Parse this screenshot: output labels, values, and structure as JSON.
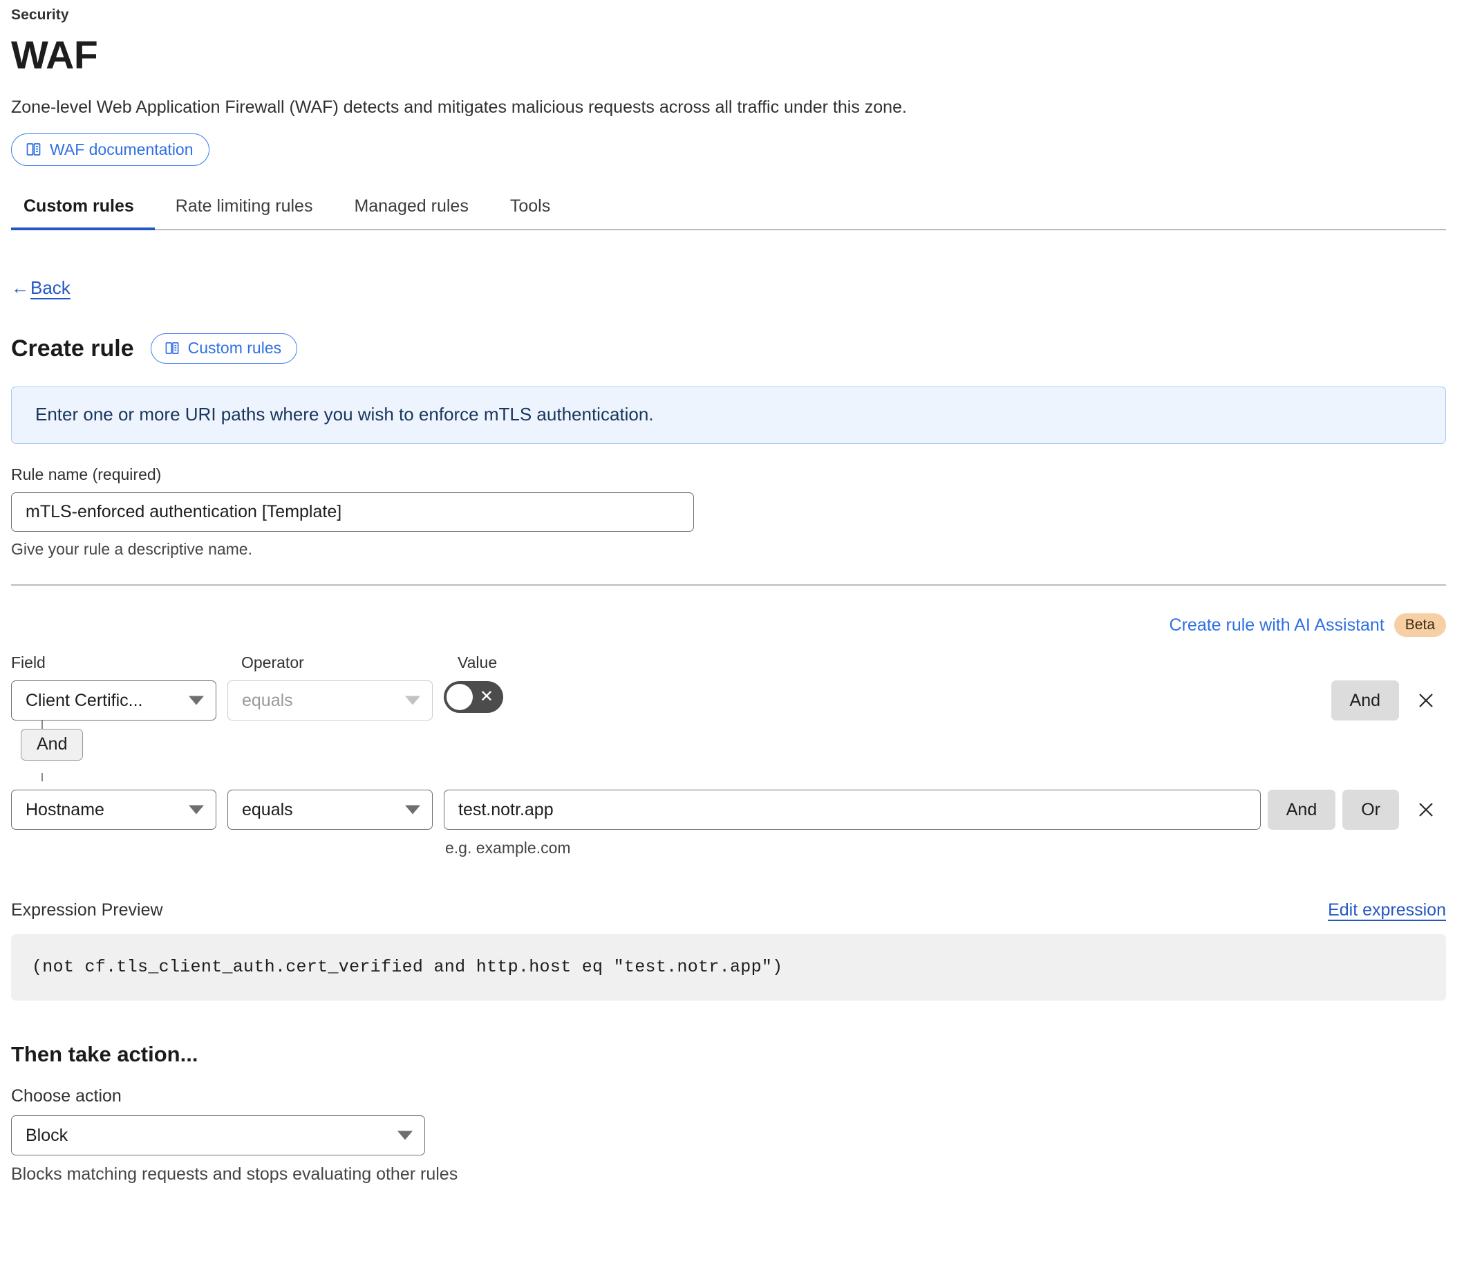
{
  "header": {
    "eyebrow": "Security",
    "title": "WAF",
    "description": "Zone-level Web Application Firewall (WAF) detects and mitigates malicious requests across all traffic under this zone.",
    "doc_button": "WAF documentation",
    "doc_icon": "book-icon"
  },
  "tabs": [
    {
      "label": "Custom rules",
      "active": true
    },
    {
      "label": "Rate limiting rules",
      "active": false
    },
    {
      "label": "Managed rules",
      "active": false
    },
    {
      "label": "Tools",
      "active": false
    }
  ],
  "back": {
    "arrow": "←",
    "label": "Back"
  },
  "create": {
    "title": "Create rule",
    "badge": "Custom rules",
    "badge_icon": "book-icon"
  },
  "banner": {
    "text": "Enter one or more URI paths where you wish to enforce mTLS authentication."
  },
  "rule_name": {
    "label": "Rule name (required)",
    "value": "mTLS-enforced authentication [Template]",
    "placeholder": "Rule name",
    "hint": "Give your rule a descriptive name."
  },
  "ai_assistant": {
    "link": "Create rule with AI Assistant",
    "badge": "Beta"
  },
  "conditions": {
    "headers": {
      "field": "Field",
      "operator": "Operator",
      "value": "Value"
    },
    "rows": [
      {
        "field": "Client Certific...",
        "operator": "equals",
        "operator_disabled": true,
        "value_type": "toggle",
        "value_toggle_on": false,
        "value_toggle_icon": "close-icon",
        "buttons": [
          "And"
        ],
        "remove_icon": "close-icon"
      },
      {
        "field": "Hostname",
        "operator": "equals",
        "operator_disabled": false,
        "value_type": "text",
        "value": "test.notr.app",
        "value_hint": "e.g. example.com",
        "buttons": [
          "And",
          "Or"
        ],
        "remove_icon": "close-icon"
      }
    ],
    "connector": "And"
  },
  "expression": {
    "label": "Expression Preview",
    "edit_link": "Edit expression",
    "text": "(not cf.tls_client_auth.cert_verified and http.host eq \"test.notr.app\")"
  },
  "action": {
    "title": "Then take action...",
    "label": "Choose action",
    "value": "Block",
    "hint": "Blocks matching requests and stops evaluating other rules"
  },
  "colors": {
    "accent_blue": "#2f6fe4",
    "link_blue": "#2457c5",
    "banner_bg": "#eef4fd",
    "banner_border": "#a9c6f3",
    "beta_bg": "#f7cfa4",
    "chip_bg": "#dcdcdc",
    "code_bg": "#f0f0f0",
    "toggle_off_bg": "#4c4c4c"
  }
}
